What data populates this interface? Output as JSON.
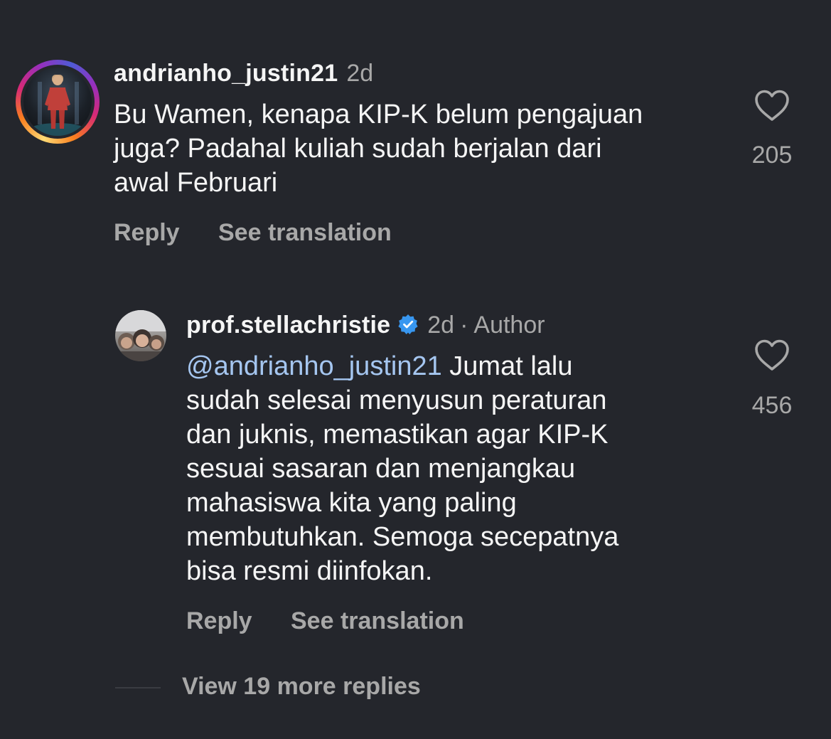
{
  "comments": [
    {
      "username": "andrianho_justin21",
      "time": "2d",
      "text_lines": [
        "Bu Wamen, kenapa KIP-K belum pengajuan",
        "juga? Padahal kuliah sudah berjalan dari",
        "awal Februari"
      ],
      "likes": "205",
      "reply_label": "Reply",
      "translate_label": "See translation",
      "avatar_icon": "profile-photo",
      "story_ring": true
    }
  ],
  "reply": {
    "username": "prof.stellachristie",
    "verified": true,
    "time": "2d",
    "separator": "·",
    "author_label": "Author",
    "mention": "@andrianho_justin21",
    "text_first": " Jumat lalu",
    "text_lines": [
      "sudah selesai menyusun peraturan",
      "dan juknis, memastikan agar KIP-K",
      "sesuai sasaran dan menjangkau",
      "mahasiswa kita yang paling",
      "membutuhkan. Semoga secepatnya",
      "bisa resmi diinfokan."
    ],
    "likes": "456",
    "reply_label": "Reply",
    "translate_label": "See translation"
  },
  "view_more": "View 19 more replies",
  "colors": {
    "background": "#24262c",
    "primary_text": "#f5f5f5",
    "secondary_text": "#a8a8a8",
    "mention": "#a5c6f0",
    "verified": "#3897f0"
  }
}
